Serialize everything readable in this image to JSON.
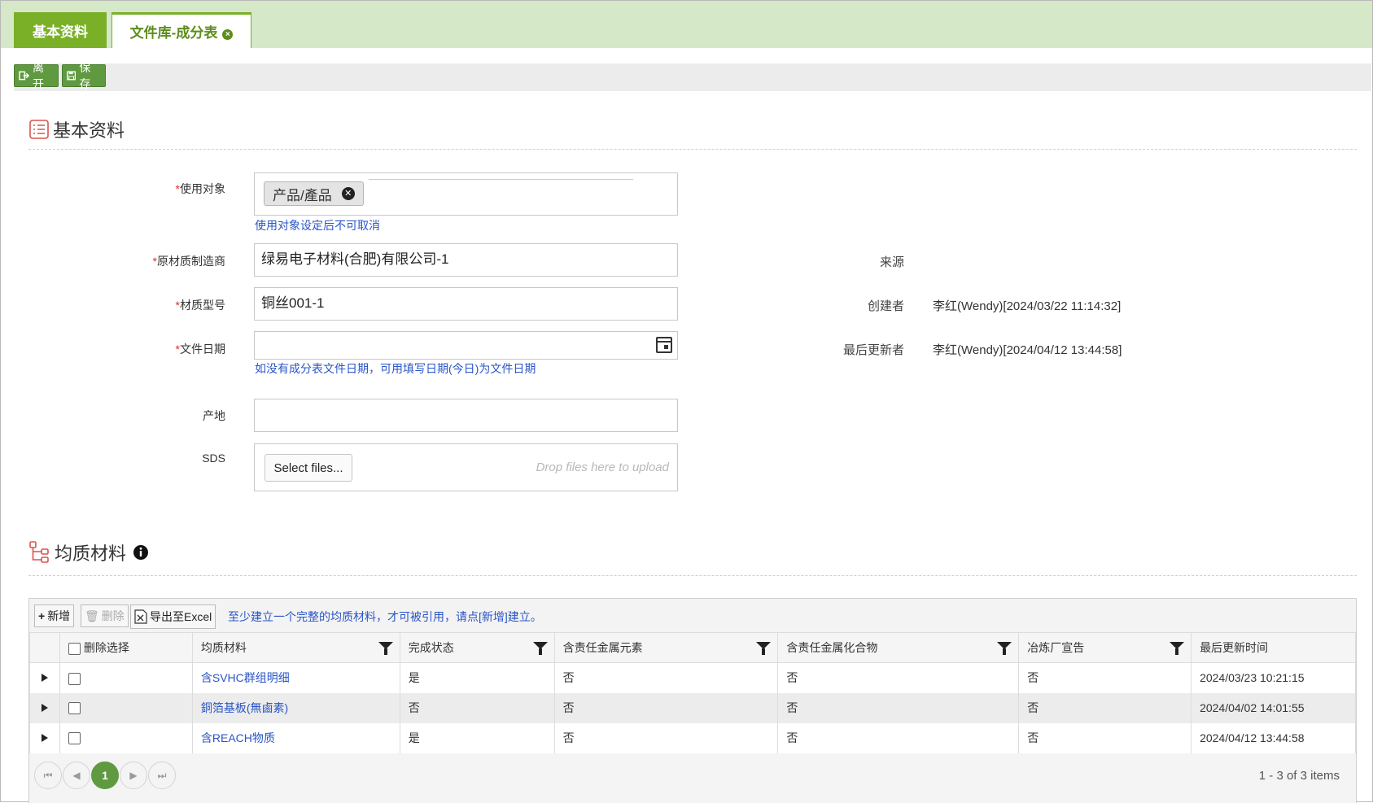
{
  "tabs": [
    {
      "label": "基本资料"
    },
    {
      "label": "文件库-成分表"
    }
  ],
  "toolbar": {
    "leave_label": "离开",
    "save_label": "保存"
  },
  "section_basic": {
    "title": "基本资料"
  },
  "form": {
    "target_label": "使用对象",
    "target_chip": "产品/產品",
    "target_hint": "使用对象设定后不可取消",
    "manufacturer_label": "原材质制造商",
    "manufacturer_value": "绿易电子材料(合肥)有限公司-1",
    "model_label": "材质型号",
    "model_value": "铜丝001-1",
    "date_label": "文件日期",
    "date_value": "",
    "date_hint": "如没有成分表文件日期，可用填写日期(今日)为文件日期",
    "origin_label": "产地",
    "origin_value": "",
    "sds_label": "SDS",
    "select_files": "Select files...",
    "drop_hint": "Drop files here to upload",
    "required_mark": "*"
  },
  "meta": {
    "source_label": "来源",
    "source_value": "",
    "creator_label": "创建者",
    "creator_value": "李红(Wendy)[2024/03/22 11:14:32]",
    "updater_label": "最后更新者",
    "updater_value": "李红(Wendy)[2024/04/12 13:44:58]"
  },
  "section_materials": {
    "title": "均质材料"
  },
  "grid": {
    "add_label": "新增",
    "delete_label": "删除",
    "export_label": "导出至Excel",
    "note": "至少建立一个完整的均质材料，才可被引用，请点[新增]建立。",
    "columns": [
      "删除选择",
      "均质材料",
      "完成状态",
      "含责任金属元素",
      "含责任金属化合物",
      "冶炼厂宣告",
      "最后更新时间"
    ],
    "rows": [
      {
        "material": "含SVHC群组明细",
        "status": "是",
        "metal": "否",
        "compound": "否",
        "smelter": "否",
        "updated": "2024/03/23 10:21:15"
      },
      {
        "material": "銅箔基板(無鹵素)",
        "status": "否",
        "metal": "否",
        "compound": "否",
        "smelter": "否",
        "updated": "2024/04/02 14:01:55"
      },
      {
        "material": "含REACH物质",
        "status": "是",
        "metal": "否",
        "compound": "否",
        "smelter": "否",
        "updated": "2024/04/12 13:44:58"
      }
    ],
    "current_page": "1",
    "page_info": "1 - 3 of 3 items"
  }
}
